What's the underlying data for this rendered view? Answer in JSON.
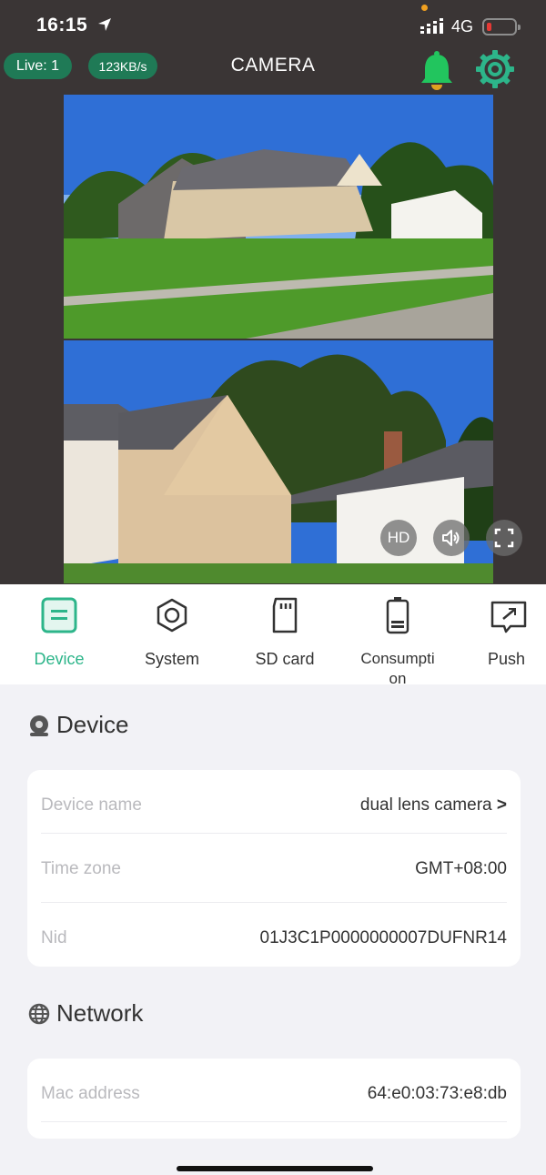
{
  "status_bar": {
    "time": "16:15",
    "network": "4G",
    "battery_level": 0.12
  },
  "header": {
    "live_label": "Live: 1",
    "speed": "123KB/s",
    "title": "CAMERA",
    "icons": [
      "bell-icon",
      "gear-icon"
    ],
    "accent": "#2db58a",
    "bell_color": "#22c55e"
  },
  "video": {
    "hd_label": "HD",
    "controls": [
      "speaker-icon",
      "fullscreen-icon"
    ]
  },
  "tabs": [
    {
      "label": "Device",
      "icon": "device-icon",
      "active": true
    },
    {
      "label": "System",
      "icon": "system-icon",
      "active": false
    },
    {
      "label": "SD card",
      "icon": "sd-card-icon",
      "active": false
    },
    {
      "label": "Consumpti\non",
      "icon": "battery-icon",
      "active": false
    },
    {
      "label": "Push",
      "icon": "push-icon",
      "active": false
    }
  ],
  "device_section": {
    "heading": "Device",
    "rows": [
      {
        "key": "Device name",
        "value": "dual lens camera",
        "chevron": ">"
      },
      {
        "key": "Time zone",
        "value": "GMT+08:00"
      },
      {
        "key": "Nid",
        "value": "01J3C1P0000000007DUFNR14"
      }
    ]
  },
  "network_section": {
    "heading": "Network",
    "rows": [
      {
        "key": "Mac address",
        "value": "64:e0:03:73:e8:db"
      }
    ]
  }
}
